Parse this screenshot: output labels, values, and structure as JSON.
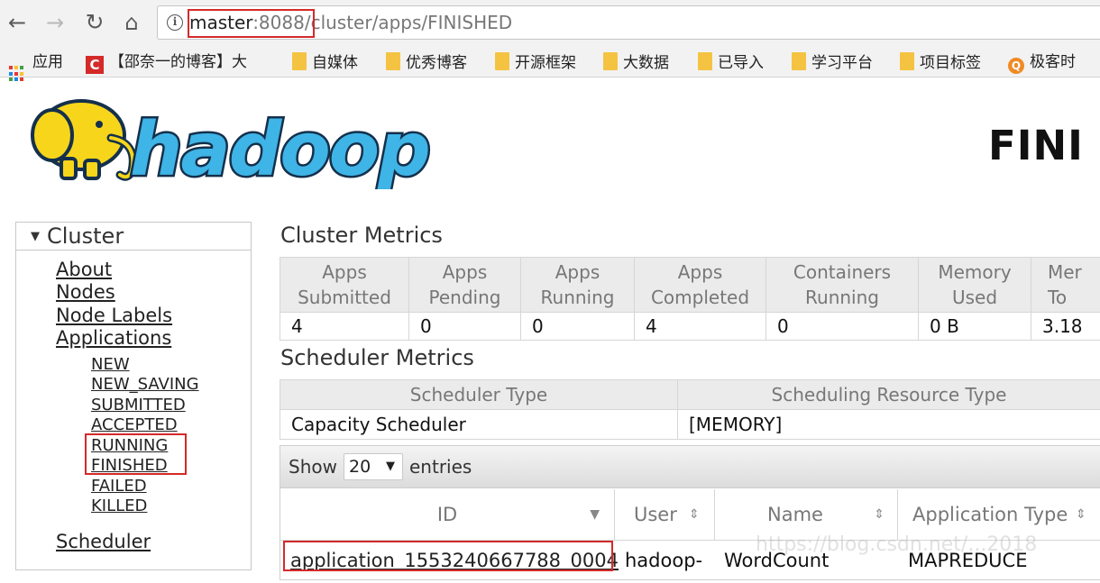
{
  "browser": {
    "url_host": "master",
    "url_port": ":8088",
    "url_path": "/cluster/apps/FINISHED",
    "bookmarks": [
      {
        "label": "应用",
        "icon": "apps-grid-icon"
      },
      {
        "label": "【邵奈一的博客】大",
        "icon": "csdn-icon",
        "icon_text": "C"
      },
      {
        "label": "自媒体",
        "icon": "folder-icon"
      },
      {
        "label": "优秀博客",
        "icon": "folder-icon"
      },
      {
        "label": "开源框架",
        "icon": "folder-icon"
      },
      {
        "label": "大数据",
        "icon": "folder-icon"
      },
      {
        "label": "已导入",
        "icon": "folder-icon"
      },
      {
        "label": "学习平台",
        "icon": "folder-icon"
      },
      {
        "label": "项目标签",
        "icon": "folder-icon"
      },
      {
        "label": "极客时",
        "icon": "geek-icon",
        "icon_text": "Q"
      }
    ]
  },
  "header": {
    "logo_text": "hadoop",
    "page_heading": "FINI"
  },
  "sidebar": {
    "title": "Cluster",
    "links": [
      "About",
      "Nodes",
      "Node Labels",
      "Applications"
    ],
    "app_states": [
      "NEW",
      "NEW_SAVING",
      "SUBMITTED",
      "ACCEPTED",
      "RUNNING",
      "FINISHED",
      "FAILED",
      "KILLED"
    ],
    "scheduler": "Scheduler"
  },
  "cluster_metrics": {
    "title": "Cluster Metrics",
    "headers": [
      [
        "Apps",
        "Submitted"
      ],
      [
        "Apps",
        "Pending"
      ],
      [
        "Apps",
        "Running"
      ],
      [
        "Apps",
        "Completed"
      ],
      [
        "Containers",
        "Running"
      ],
      [
        "Memory",
        "Used"
      ],
      [
        "Mer",
        "To"
      ]
    ],
    "values": [
      "4",
      "0",
      "0",
      "4",
      "0",
      "0 B",
      "3.18"
    ]
  },
  "scheduler_metrics": {
    "title": "Scheduler Metrics",
    "headers": [
      "Scheduler Type",
      "Scheduling Resource Type"
    ],
    "values": [
      "Capacity Scheduler",
      "[MEMORY]"
    ]
  },
  "apps_table": {
    "show_label": "Show",
    "entries_value": "20",
    "entries_label": "entries",
    "columns": [
      "ID",
      "User",
      "Name",
      "Application Type"
    ],
    "rows": [
      {
        "id": "application_1553240667788_0004",
        "user": "hadoop-",
        "name": "WordCount",
        "type": "MAPREDUCE"
      }
    ]
  },
  "watermark": "https://blog.csdn.net/...2018",
  "colors": {
    "highlight_red": "#d42a2a",
    "logo_yellow": "#f7d51b",
    "logo_blue": "#3fb4e6",
    "logo_dark": "#14304c"
  }
}
